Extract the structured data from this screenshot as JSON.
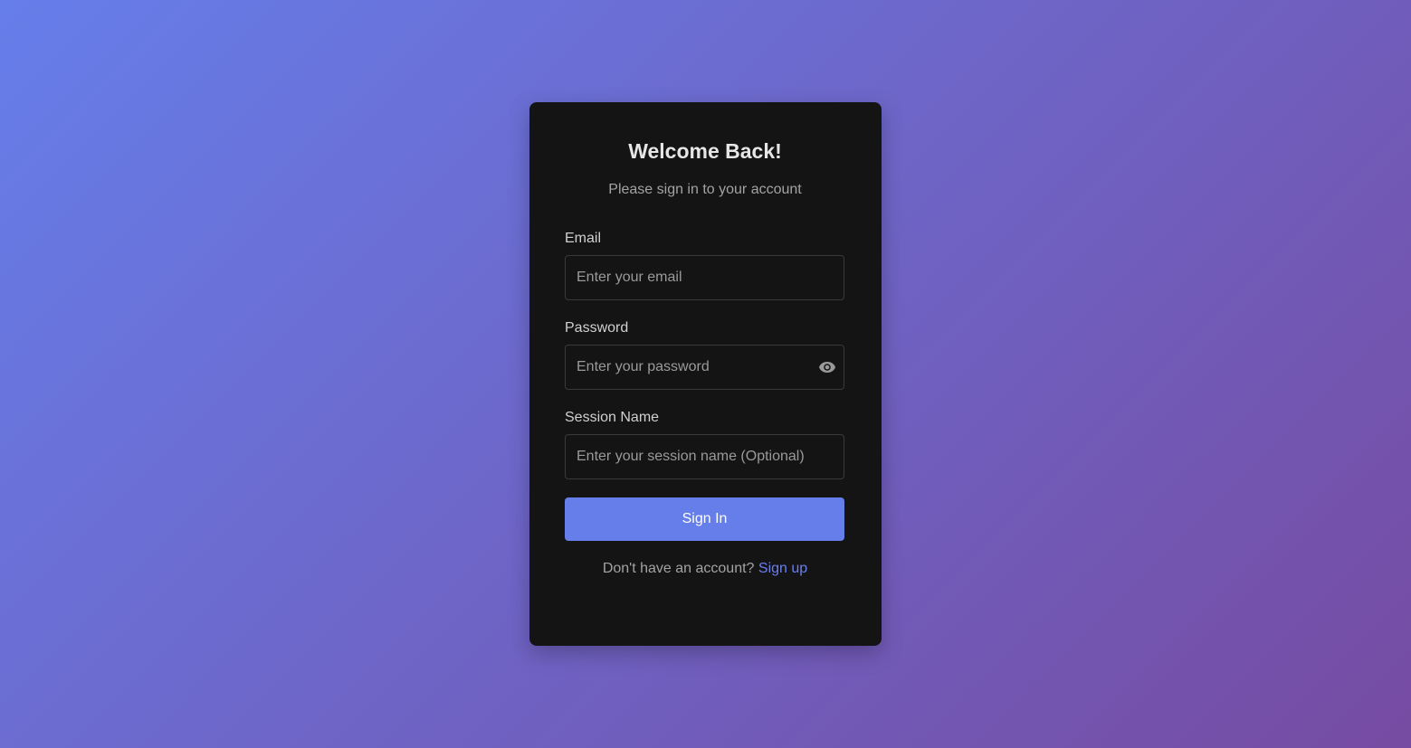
{
  "login": {
    "title": "Welcome Back!",
    "subtitle": "Please sign in to your account",
    "email": {
      "label": "Email",
      "placeholder": "Enter your email",
      "value": ""
    },
    "password": {
      "label": "Password",
      "placeholder": "Enter your password",
      "value": "",
      "toggle_icon": "eye-icon"
    },
    "session": {
      "label": "Session Name",
      "placeholder": "Enter your session name (Optional)",
      "value": ""
    },
    "submit_label": "Sign In",
    "footer_text": "Don't have an account?",
    "footer_link": "Sign up"
  },
  "colors": {
    "gradient_start": "#667eea",
    "gradient_end": "#764ba2",
    "card_bg": "#141414",
    "accent": "#667eea",
    "link": "#6b7ff0"
  }
}
